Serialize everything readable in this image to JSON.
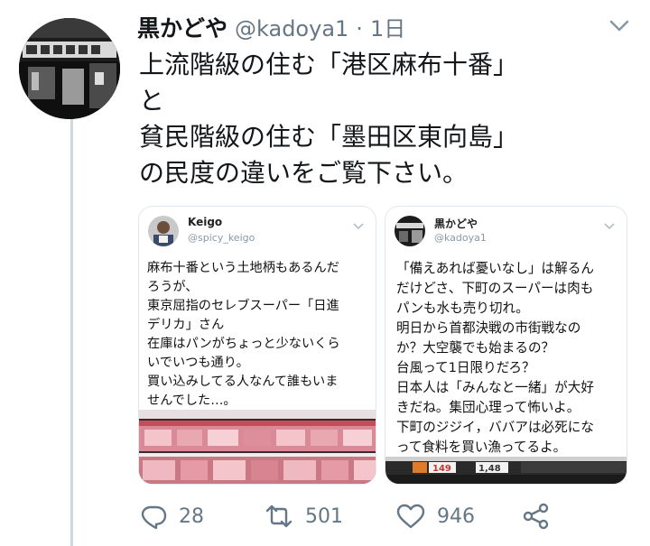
{
  "tweet": {
    "display_name": "黒かどや",
    "handle": "@kadoya1",
    "separator": "·",
    "time": "1日",
    "text_lines": [
      "上流階級の住む「港区麻布十番」",
      "と",
      "貧民階級の住む「墨田区東向島」",
      "の民度の違いをご覧下さい。"
    ]
  },
  "cards": {
    "left": {
      "name": "Keigo",
      "handle": "@spicy_keigo",
      "lines": [
        "麻布十番という土地柄もあるんだ",
        "ろうが、",
        "東京屈指のセレブスーパー「日進",
        "デリカ」さん",
        "在庫はパンがちょっと少ないくら",
        "いでいつも通り。",
        "買い込みしてる人なんて誰もいま",
        "せんでした…。"
      ]
    },
    "right": {
      "name": "黒かどや",
      "handle": "@kadoya1",
      "lines": [
        "「備えあれば憂いなし」は解るん",
        "だけどさ、下町のスーパーは肉も",
        "パンも水も売り切れ。",
        "明日から首都決戦の市街戦なの",
        "か？大空襲でも始まるの？",
        "台風って1日限りだろ？",
        "日本人は「みんなと一緒」が大好",
        "きだね。集団心理って怖いよ。",
        "下町のジジイ，ババアは必死にな",
        "って食料を買い漁ってるよ。"
      ],
      "price_tags": [
        "149",
        "1,48"
      ]
    }
  },
  "actions": {
    "reply_count": "28",
    "retweet_count": "501",
    "like_count": "946"
  },
  "icons": {
    "reply": "reply-icon",
    "retweet": "retweet-icon",
    "like": "heart-icon",
    "share": "share-icon",
    "menu": "chevron-down-icon"
  },
  "colors": {
    "text": "#14171a",
    "muted": "#657786",
    "thread_line": "#cfd9de",
    "card_border": "#e1e8ed"
  }
}
